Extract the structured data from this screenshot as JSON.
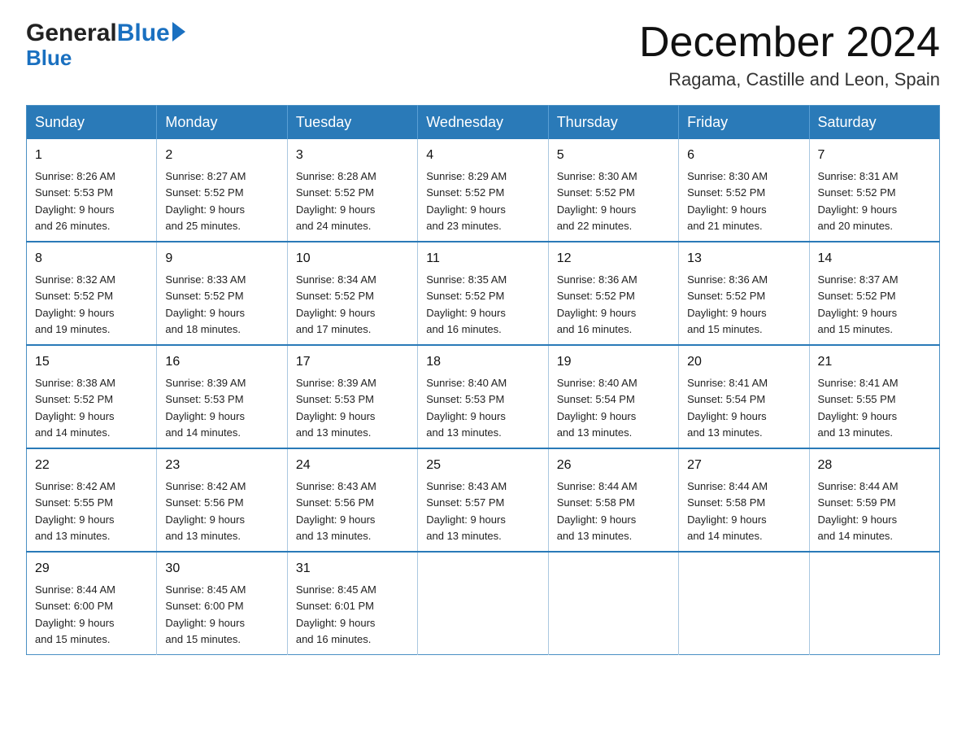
{
  "header": {
    "logo_general": "General",
    "logo_blue": "Blue",
    "calendar_title": "December 2024",
    "calendar_subtitle": "Ragama, Castille and Leon, Spain"
  },
  "weekdays": [
    "Sunday",
    "Monday",
    "Tuesday",
    "Wednesday",
    "Thursday",
    "Friday",
    "Saturday"
  ],
  "weeks": [
    [
      {
        "day": "1",
        "sunrise": "8:26 AM",
        "sunset": "5:53 PM",
        "daylight": "9 hours and 26 minutes."
      },
      {
        "day": "2",
        "sunrise": "8:27 AM",
        "sunset": "5:52 PM",
        "daylight": "9 hours and 25 minutes."
      },
      {
        "day": "3",
        "sunrise": "8:28 AM",
        "sunset": "5:52 PM",
        "daylight": "9 hours and 24 minutes."
      },
      {
        "day": "4",
        "sunrise": "8:29 AM",
        "sunset": "5:52 PM",
        "daylight": "9 hours and 23 minutes."
      },
      {
        "day": "5",
        "sunrise": "8:30 AM",
        "sunset": "5:52 PM",
        "daylight": "9 hours and 22 minutes."
      },
      {
        "day": "6",
        "sunrise": "8:30 AM",
        "sunset": "5:52 PM",
        "daylight": "9 hours and 21 minutes."
      },
      {
        "day": "7",
        "sunrise": "8:31 AM",
        "sunset": "5:52 PM",
        "daylight": "9 hours and 20 minutes."
      }
    ],
    [
      {
        "day": "8",
        "sunrise": "8:32 AM",
        "sunset": "5:52 PM",
        "daylight": "9 hours and 19 minutes."
      },
      {
        "day": "9",
        "sunrise": "8:33 AM",
        "sunset": "5:52 PM",
        "daylight": "9 hours and 18 minutes."
      },
      {
        "day": "10",
        "sunrise": "8:34 AM",
        "sunset": "5:52 PM",
        "daylight": "9 hours and 17 minutes."
      },
      {
        "day": "11",
        "sunrise": "8:35 AM",
        "sunset": "5:52 PM",
        "daylight": "9 hours and 16 minutes."
      },
      {
        "day": "12",
        "sunrise": "8:36 AM",
        "sunset": "5:52 PM",
        "daylight": "9 hours and 16 minutes."
      },
      {
        "day": "13",
        "sunrise": "8:36 AM",
        "sunset": "5:52 PM",
        "daylight": "9 hours and 15 minutes."
      },
      {
        "day": "14",
        "sunrise": "8:37 AM",
        "sunset": "5:52 PM",
        "daylight": "9 hours and 15 minutes."
      }
    ],
    [
      {
        "day": "15",
        "sunrise": "8:38 AM",
        "sunset": "5:52 PM",
        "daylight": "9 hours and 14 minutes."
      },
      {
        "day": "16",
        "sunrise": "8:39 AM",
        "sunset": "5:53 PM",
        "daylight": "9 hours and 14 minutes."
      },
      {
        "day": "17",
        "sunrise": "8:39 AM",
        "sunset": "5:53 PM",
        "daylight": "9 hours and 13 minutes."
      },
      {
        "day": "18",
        "sunrise": "8:40 AM",
        "sunset": "5:53 PM",
        "daylight": "9 hours and 13 minutes."
      },
      {
        "day": "19",
        "sunrise": "8:40 AM",
        "sunset": "5:54 PM",
        "daylight": "9 hours and 13 minutes."
      },
      {
        "day": "20",
        "sunrise": "8:41 AM",
        "sunset": "5:54 PM",
        "daylight": "9 hours and 13 minutes."
      },
      {
        "day": "21",
        "sunrise": "8:41 AM",
        "sunset": "5:55 PM",
        "daylight": "9 hours and 13 minutes."
      }
    ],
    [
      {
        "day": "22",
        "sunrise": "8:42 AM",
        "sunset": "5:55 PM",
        "daylight": "9 hours and 13 minutes."
      },
      {
        "day": "23",
        "sunrise": "8:42 AM",
        "sunset": "5:56 PM",
        "daylight": "9 hours and 13 minutes."
      },
      {
        "day": "24",
        "sunrise": "8:43 AM",
        "sunset": "5:56 PM",
        "daylight": "9 hours and 13 minutes."
      },
      {
        "day": "25",
        "sunrise": "8:43 AM",
        "sunset": "5:57 PM",
        "daylight": "9 hours and 13 minutes."
      },
      {
        "day": "26",
        "sunrise": "8:44 AM",
        "sunset": "5:58 PM",
        "daylight": "9 hours and 13 minutes."
      },
      {
        "day": "27",
        "sunrise": "8:44 AM",
        "sunset": "5:58 PM",
        "daylight": "9 hours and 14 minutes."
      },
      {
        "day": "28",
        "sunrise": "8:44 AM",
        "sunset": "5:59 PM",
        "daylight": "9 hours and 14 minutes."
      }
    ],
    [
      {
        "day": "29",
        "sunrise": "8:44 AM",
        "sunset": "6:00 PM",
        "daylight": "9 hours and 15 minutes."
      },
      {
        "day": "30",
        "sunrise": "8:45 AM",
        "sunset": "6:00 PM",
        "daylight": "9 hours and 15 minutes."
      },
      {
        "day": "31",
        "sunrise": "8:45 AM",
        "sunset": "6:01 PM",
        "daylight": "9 hours and 16 minutes."
      },
      null,
      null,
      null,
      null
    ]
  ],
  "labels": {
    "sunrise": "Sunrise:",
    "sunset": "Sunset:",
    "daylight": "Daylight:"
  }
}
